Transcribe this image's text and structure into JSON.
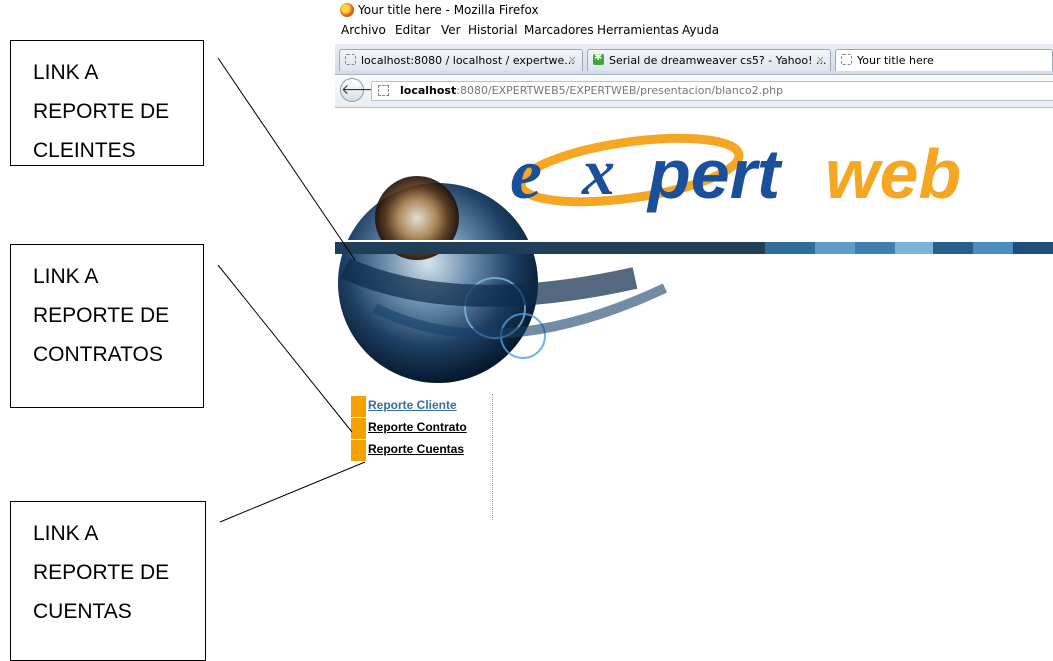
{
  "annotations": [
    {
      "lines": [
        "LINK A",
        "REPORTE DE",
        "CLEINTES"
      ]
    },
    {
      "lines": [
        "LINK A",
        "REPORTE DE",
        "CONTRATOS"
      ]
    },
    {
      "lines": [
        "LINK A",
        "REPORTE DE",
        "CUENTAS"
      ]
    }
  ],
  "window": {
    "title": "Your title here - Mozilla Firefox"
  },
  "menubar": [
    "Archivo",
    "Editar",
    "Ver",
    "Historial",
    "Marcadores",
    "Herramientas",
    "Ayuda"
  ],
  "tabs": [
    {
      "label": "localhost:8080 / localhost / expertwe...",
      "icon": "blank-page-icon"
    },
    {
      "label": "Serial de dreamweaver cs5? - Yahoo! ...",
      "icon": "yahoo-answers-icon"
    },
    {
      "label": "Your title here",
      "icon": "blank-page-icon"
    }
  ],
  "address": {
    "host": "localhost",
    "rest": ":8080/EXPERTWEB5/EXPERTWEB/presentacion/blanco2.php"
  },
  "logo": {
    "part1": "e",
    "part2": "x",
    "part3": "pert",
    "part4": "web"
  },
  "sidebar_menu": [
    {
      "label": "Reporte Cliente",
      "visited": true
    },
    {
      "label": "Reporte Contrato",
      "visited": false
    },
    {
      "label": "Reporte Cuentas",
      "visited": false
    }
  ],
  "colors": {
    "accent_orange": "#f5a100",
    "logo_blue": "#1a4f9c",
    "logo_orange": "#f5a623",
    "visited_link": "#3a6ea0"
  }
}
